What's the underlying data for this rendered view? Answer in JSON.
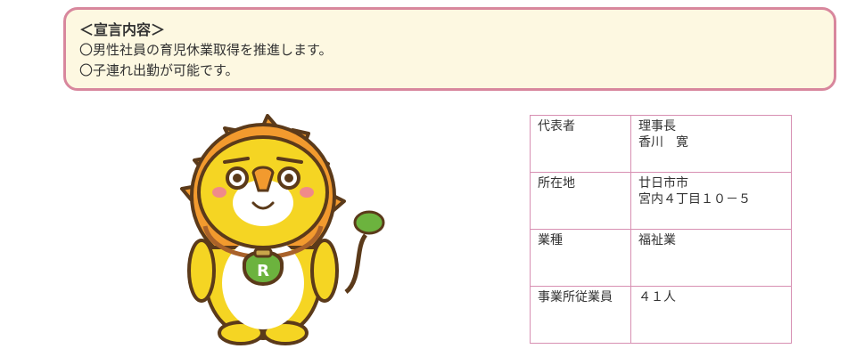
{
  "declaration": {
    "heading": "＜宣言内容＞",
    "items": [
      "〇男性社員の育児休業取得を推進します。",
      "〇子連れ出勤が可能です。"
    ]
  },
  "info_table": {
    "rows": [
      {
        "label": "代表者",
        "value_lines": [
          "理事長",
          "香川　寛"
        ]
      },
      {
        "label": "所在地",
        "value_lines": [
          "廿日市市",
          "宮内４丁目１０－５"
        ]
      },
      {
        "label": "業種",
        "value_lines": [
          "福祉業"
        ]
      },
      {
        "label": "事業所従業員",
        "value_lines": [
          "４１人"
        ]
      }
    ]
  },
  "mascot": {
    "icon": "lion-mascot-icon",
    "badge_letter": "R",
    "colors": {
      "body": "#f5d523",
      "mane": "#f29a2e",
      "outline": "#5b3a1a",
      "belly": "#ffffff",
      "pouch": "#6cb33e"
    }
  }
}
